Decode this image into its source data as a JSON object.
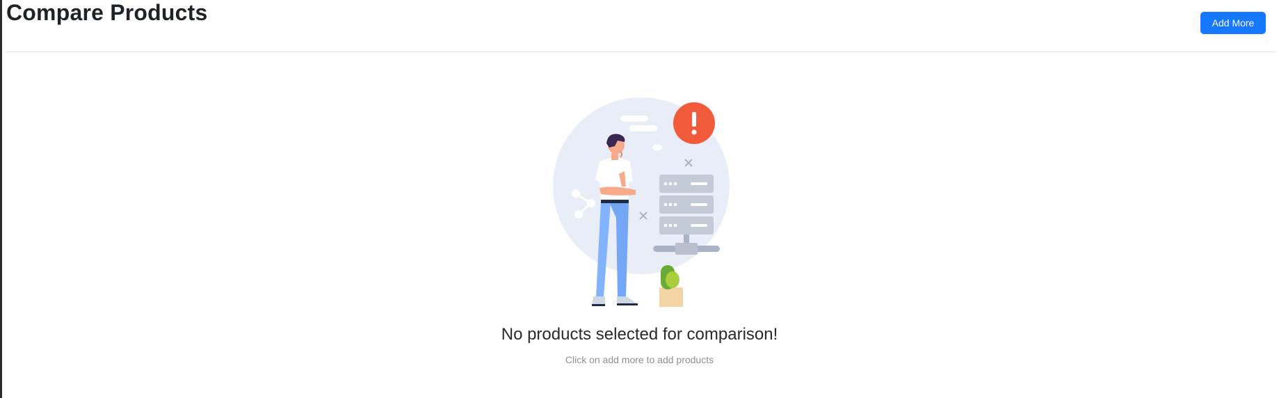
{
  "header": {
    "title": "Compare Products",
    "add_more_label": "Add More"
  },
  "empty_state": {
    "title": "No products selected for comparison!",
    "subtitle": "Click on add more to add products",
    "illustration_icon": "empty-state-illustration-icon",
    "alert_icon": "exclamation-icon"
  },
  "colors": {
    "primary": "#1677ff",
    "alert": "#f25a3c",
    "illustration_bg": "#e9edf7",
    "server": "#c3cad8"
  }
}
